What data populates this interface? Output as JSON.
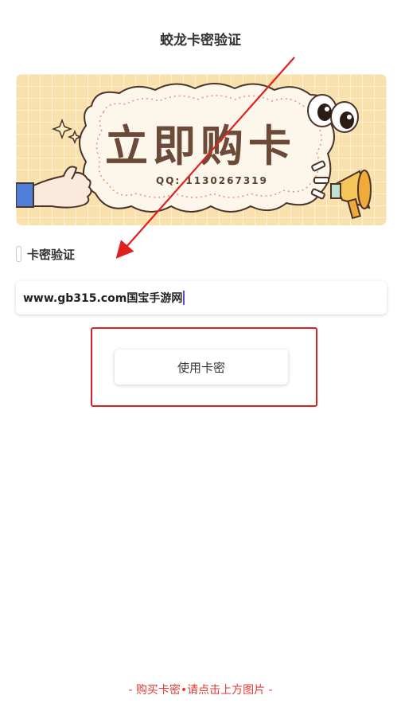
{
  "header": {
    "title": "蛟龙卡密验证"
  },
  "banner": {
    "title": "立即购卡",
    "qq": "QQ: 1130267319"
  },
  "section": {
    "label": "卡密验证"
  },
  "input": {
    "value": "www.gb315.com国宝手游网"
  },
  "button": {
    "label": "使用卡密"
  },
  "footer": {
    "text": "- 购买卡密•请点击上方图片 -"
  },
  "colors": {
    "accent_red": "#e02020",
    "footer_red": "#e53935",
    "banner_bg": "#f8e1ad"
  }
}
